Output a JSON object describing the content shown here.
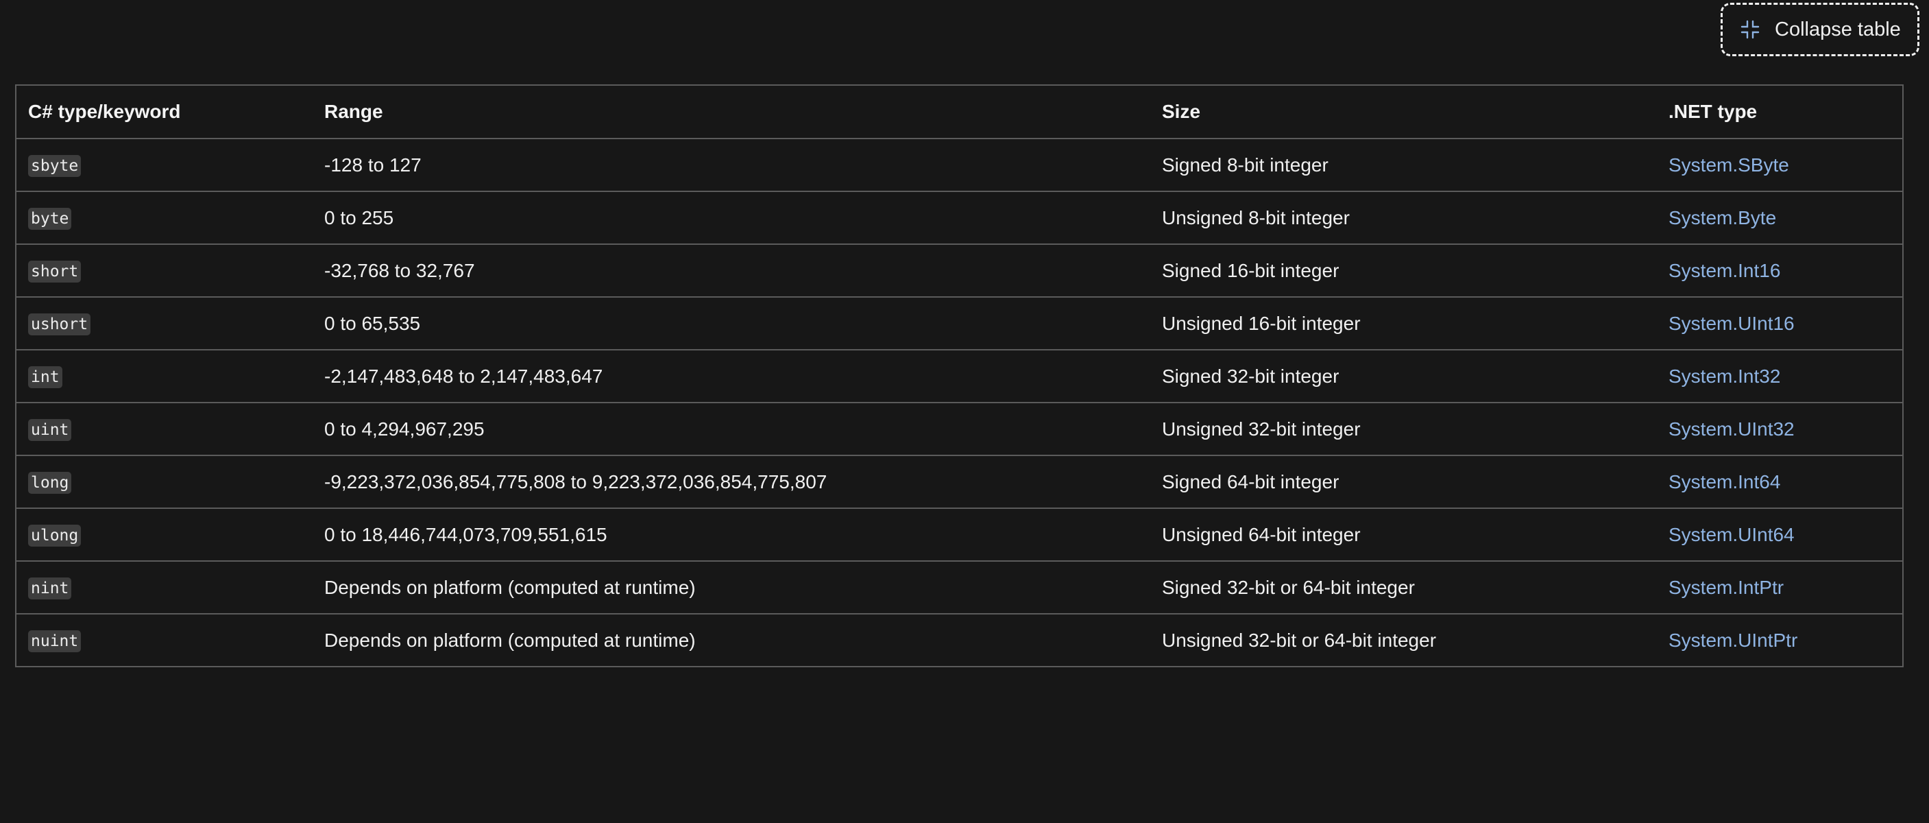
{
  "collapse_button": {
    "label": "Collapse table",
    "icon": "collapse-icon"
  },
  "table": {
    "headers": [
      "C# type/keyword",
      "Range",
      "Size",
      ".NET type"
    ],
    "rows": [
      {
        "keyword": "sbyte",
        "range": "-128 to 127",
        "size": "Signed 8-bit integer",
        "net_type": "System.SByte"
      },
      {
        "keyword": "byte",
        "range": "0 to 255",
        "size": "Unsigned 8-bit integer",
        "net_type": "System.Byte"
      },
      {
        "keyword": "short",
        "range": "-32,768 to 32,767",
        "size": "Signed 16-bit integer",
        "net_type": "System.Int16"
      },
      {
        "keyword": "ushort",
        "range": "0 to 65,535",
        "size": "Unsigned 16-bit integer",
        "net_type": "System.UInt16"
      },
      {
        "keyword": "int",
        "range": "-2,147,483,648 to 2,147,483,647",
        "size": "Signed 32-bit integer",
        "net_type": "System.Int32"
      },
      {
        "keyword": "uint",
        "range": "0 to 4,294,967,295",
        "size": "Unsigned 32-bit integer",
        "net_type": "System.UInt32"
      },
      {
        "keyword": "long",
        "range": "-9,223,372,036,854,775,808 to 9,223,372,036,854,775,807",
        "size": "Signed 64-bit integer",
        "net_type": "System.Int64"
      },
      {
        "keyword": "ulong",
        "range": "0 to 18,446,744,073,709,551,615",
        "size": "Unsigned 64-bit integer",
        "net_type": "System.UInt64"
      },
      {
        "keyword": "nint",
        "range": "Depends on platform (computed at runtime)",
        "size": "Signed 32-bit or 64-bit integer",
        "net_type": "System.IntPtr"
      },
      {
        "keyword": "nuint",
        "range": "Depends on platform (computed at runtime)",
        "size": "Unsigned 32-bit or 64-bit integer",
        "net_type": "System.UIntPtr"
      }
    ]
  },
  "colors": {
    "background": "#171717",
    "border": "#5b5b5b",
    "link": "#8fb4e3",
    "code_bg": "#3d3d3d"
  }
}
